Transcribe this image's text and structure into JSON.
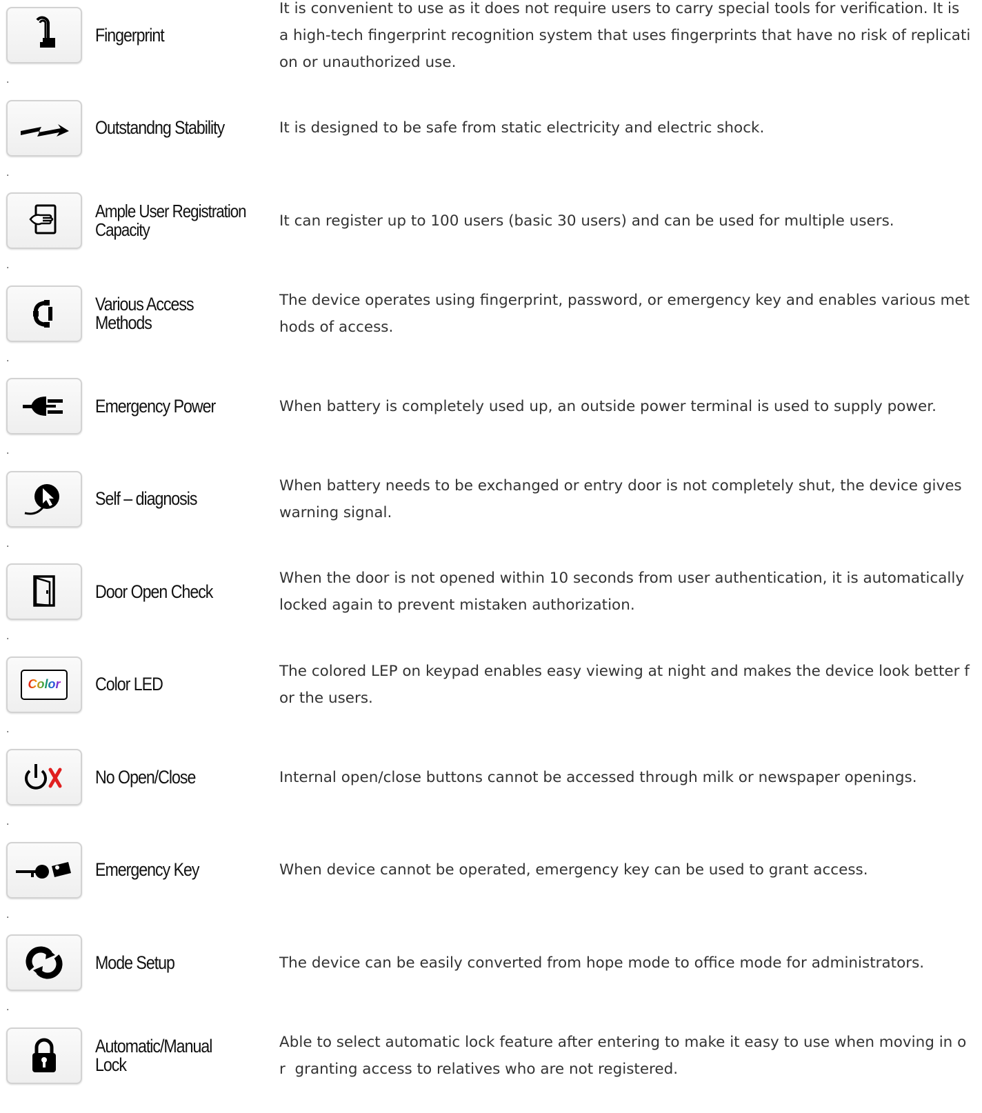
{
  "features": [
    {
      "icon": "fingerprint-icon",
      "label": "Fingerprint",
      "description": "It is convenient to use as it does not require users to carry special tools for verification. It is a high-tech fingerprint recognition system that uses fingerprints that have no risk of replication or unauthorized use.",
      "separator": "."
    },
    {
      "icon": "lightning-arrow-icon",
      "label": "Outstandng Stability",
      "description": "It is designed to be safe from static electricity and electric shock.",
      "separator": "."
    },
    {
      "icon": "hand-card-icon",
      "label": "Ample User Registration Capacity",
      "description": "It can register up to 100 users (basic 30 users) and can be used for multiple users.",
      "separator": "."
    },
    {
      "icon": "access-methods-icon",
      "label": "Various Access Methods",
      "description": "The device operates using fingerprint, password, or emergency key and enables various methods of access.",
      "separator": "."
    },
    {
      "icon": "power-plug-icon",
      "label": "Emergency Power",
      "description": "When battery is completely used up, an outside power terminal is used to supply power.",
      "separator": "."
    },
    {
      "icon": "diagnosis-cursor-icon",
      "label": "Self – diagnosis",
      "description": "When battery needs to be exchanged or entry door is not completely shut, the device gives warning signal.",
      "separator": "."
    },
    {
      "icon": "door-icon",
      "label": "Door Open Check",
      "description": "When the door is not opened within 10 seconds from user authentication, it is automatically locked again to prevent mistaken authorization.",
      "separator": "."
    },
    {
      "icon": "color-led-icon",
      "label": "Color LED",
      "icon_text": "Color",
      "description": "The colored LEP on keypad enables easy viewing at night and makes the device look better for the users.",
      "separator": "."
    },
    {
      "icon": "power-off-x-icon",
      "label": "No Open/Close",
      "description": "Internal open/close buttons cannot be accessed through milk or newspaper openings.",
      "separator": "."
    },
    {
      "icon": "key-icon",
      "label": "Emergency Key",
      "description": "When device cannot be operated, emergency key can be used to grant access.",
      "separator": "."
    },
    {
      "icon": "mode-cycle-icon",
      "label": "Mode Setup",
      "description": "The device can be easily converted from hope mode to office mode for administrators.",
      "separator": "."
    },
    {
      "icon": "padlock-icon",
      "label": "Automatic/Manual Lock",
      "description": "Able to select automatic lock feature after entering to make it easy to use when moving in or  granting access to relatives who are not registered.",
      "separator": ""
    }
  ]
}
